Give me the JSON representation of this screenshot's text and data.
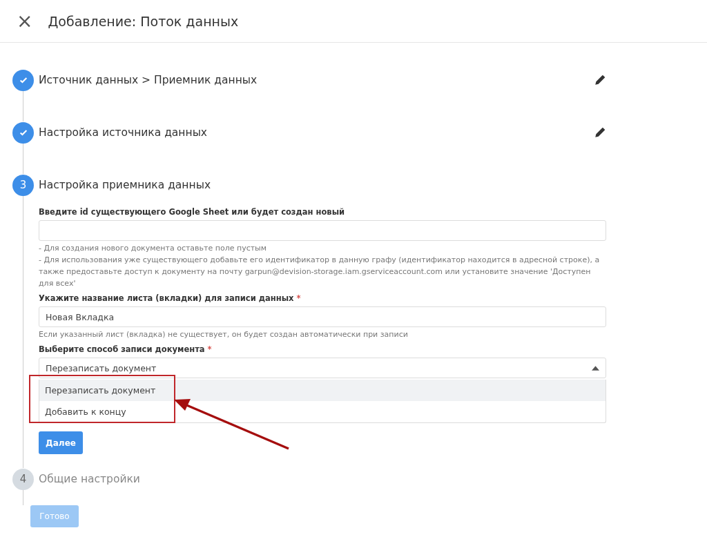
{
  "header": {
    "close": "×",
    "title": "Добавление: Поток данных"
  },
  "steps": [
    {
      "kind": "done",
      "title": "Источник данных > Приемник данных",
      "editable": true
    },
    {
      "kind": "done",
      "title": "Настройка источника данных",
      "editable": true
    },
    {
      "kind": "active",
      "number": "3",
      "title": "Настройка приемника данных",
      "editable": false
    },
    {
      "kind": "pending",
      "number": "4",
      "title": "Общие настройки",
      "editable": false
    }
  ],
  "form": {
    "required_mark": "*",
    "sheet_id": {
      "label": "Введите id существующего Google Sheet или будет создан новый",
      "required": false,
      "hints": [
        "- Для создания нового документа оставьте поле пустым",
        "- Для использования уже существующего добавьте его идентификатор в данную графу (идентификатор находится в адресной строке), а также предоставьте доступ к документу на почту garpun@devision-storage.iam.gserviceaccount.com или установите значение 'Доступен для всех'"
      ]
    },
    "sheet_name": {
      "label": "Укажите название листа (вкладки) для записи данных",
      "required": true,
      "value": "Новая Вкладка",
      "hint": "Если указанный лист (вкладка) не существует, он будет создан автоматически при записи"
    },
    "write_mode": {
      "label": "Выберите способ записи документа",
      "required": true,
      "value": "Перезаписать документ",
      "expanded": true,
      "options": [
        {
          "label": "Перезаписать документ",
          "selected": true
        },
        {
          "label": "Добавить к концу",
          "selected": false
        }
      ]
    },
    "next_button": "Далее"
  },
  "done_button": {
    "label": "Готово",
    "disabled": true
  }
}
